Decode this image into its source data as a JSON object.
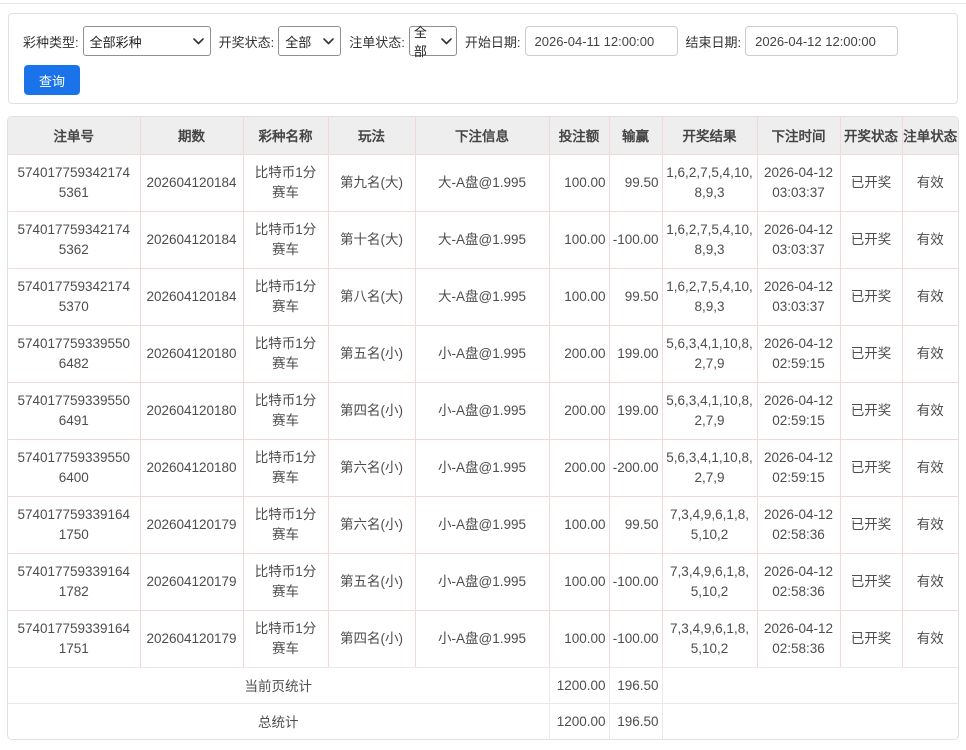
{
  "filters": {
    "lottery_type": {
      "label": "彩种类型:",
      "value": "全部彩种"
    },
    "draw_status": {
      "label": "开奖状态:",
      "value": "全部"
    },
    "order_status": {
      "label": "注单状态:",
      "value": "全部"
    },
    "start_date": {
      "label": "开始日期:",
      "value": "2026-04-11 12:00:00"
    },
    "end_date": {
      "label": "结束日期:",
      "value": "2026-04-12 12:00:00"
    },
    "query_label": "查询"
  },
  "table": {
    "columns": [
      {
        "key": "order_no",
        "label": "注单号"
      },
      {
        "key": "period",
        "label": "期数"
      },
      {
        "key": "lottery_name",
        "label": "彩种名称"
      },
      {
        "key": "play",
        "label": "玩法"
      },
      {
        "key": "bet_info",
        "label": "下注信息"
      },
      {
        "key": "bet_amount",
        "label": "投注额"
      },
      {
        "key": "win_loss",
        "label": "输赢"
      },
      {
        "key": "result",
        "label": "开奖结果"
      },
      {
        "key": "bet_time",
        "label": "下注时间"
      },
      {
        "key": "draw_status",
        "label": "开奖状态"
      },
      {
        "key": "order_status",
        "label": "注单状态"
      }
    ],
    "rows": [
      {
        "order_no": "5740177593421745361",
        "period": "202604120184",
        "lottery_name": "比特币1分赛车",
        "play": "第九名(大)",
        "bet_info": "大-A盘@1.995",
        "bet_amount": "100.00",
        "win_loss": "99.50",
        "result": "1,6,2,7,5,4,10,8,9,3",
        "bet_time": "2026-04-12 03:03:37",
        "draw_status": "已开奖",
        "order_status": "有效"
      },
      {
        "order_no": "5740177593421745362",
        "period": "202604120184",
        "lottery_name": "比特币1分赛车",
        "play": "第十名(大)",
        "bet_info": "大-A盘@1.995",
        "bet_amount": "100.00",
        "win_loss": "-100.00",
        "result": "1,6,2,7,5,4,10,8,9,3",
        "bet_time": "2026-04-12 03:03:37",
        "draw_status": "已开奖",
        "order_status": "有效"
      },
      {
        "order_no": "5740177593421745370",
        "period": "202604120184",
        "lottery_name": "比特币1分赛车",
        "play": "第八名(大)",
        "bet_info": "大-A盘@1.995",
        "bet_amount": "100.00",
        "win_loss": "99.50",
        "result": "1,6,2,7,5,4,10,8,9,3",
        "bet_time": "2026-04-12 03:03:37",
        "draw_status": "已开奖",
        "order_status": "有效"
      },
      {
        "order_no": "5740177593395506482",
        "period": "202604120180",
        "lottery_name": "比特币1分赛车",
        "play": "第五名(小)",
        "bet_info": "小-A盘@1.995",
        "bet_amount": "200.00",
        "win_loss": "199.00",
        "result": "5,6,3,4,1,10,8,2,7,9",
        "bet_time": "2026-04-12 02:59:15",
        "draw_status": "已开奖",
        "order_status": "有效"
      },
      {
        "order_no": "5740177593395506491",
        "period": "202604120180",
        "lottery_name": "比特币1分赛车",
        "play": "第四名(小)",
        "bet_info": "小-A盘@1.995",
        "bet_amount": "200.00",
        "win_loss": "199.00",
        "result": "5,6,3,4,1,10,8,2,7,9",
        "bet_time": "2026-04-12 02:59:15",
        "draw_status": "已开奖",
        "order_status": "有效"
      },
      {
        "order_no": "5740177593395506400",
        "period": "202604120180",
        "lottery_name": "比特币1分赛车",
        "play": "第六名(小)",
        "bet_info": "小-A盘@1.995",
        "bet_amount": "200.00",
        "win_loss": "-200.00",
        "result": "5,6,3,4,1,10,8,2,7,9",
        "bet_time": "2026-04-12 02:59:15",
        "draw_status": "已开奖",
        "order_status": "有效"
      },
      {
        "order_no": "5740177593391641750",
        "period": "202604120179",
        "lottery_name": "比特币1分赛车",
        "play": "第六名(小)",
        "bet_info": "小-A盘@1.995",
        "bet_amount": "100.00",
        "win_loss": "99.50",
        "result": "7,3,4,9,6,1,8,5,10,2",
        "bet_time": "2026-04-12 02:58:36",
        "draw_status": "已开奖",
        "order_status": "有效"
      },
      {
        "order_no": "5740177593391641782",
        "period": "202604120179",
        "lottery_name": "比特币1分赛车",
        "play": "第五名(小)",
        "bet_info": "小-A盘@1.995",
        "bet_amount": "100.00",
        "win_loss": "-100.00",
        "result": "7,3,4,9,6,1,8,5,10,2",
        "bet_time": "2026-04-12 02:58:36",
        "draw_status": "已开奖",
        "order_status": "有效"
      },
      {
        "order_no": "5740177593391641751",
        "period": "202604120179",
        "lottery_name": "比特币1分赛车",
        "play": "第四名(小)",
        "bet_info": "小-A盘@1.995",
        "bet_amount": "100.00",
        "win_loss": "-100.00",
        "result": "7,3,4,9,6,1,8,5,10,2",
        "bet_time": "2026-04-12 02:58:36",
        "draw_status": "已开奖",
        "order_status": "有效"
      }
    ],
    "page_summary": {
      "label": "当前页统计",
      "bet_total": "1200.00",
      "win_total": "196.50"
    },
    "total_summary": {
      "label": "总统计",
      "bet_total": "1200.00",
      "win_total": "196.50"
    }
  },
  "colors": {
    "accent": "#1a73e8",
    "border_pink": "#f2d8d8",
    "border_gray": "#e0e0e0",
    "header_bg": "#eeeeee",
    "text": "#4d4d4d"
  }
}
